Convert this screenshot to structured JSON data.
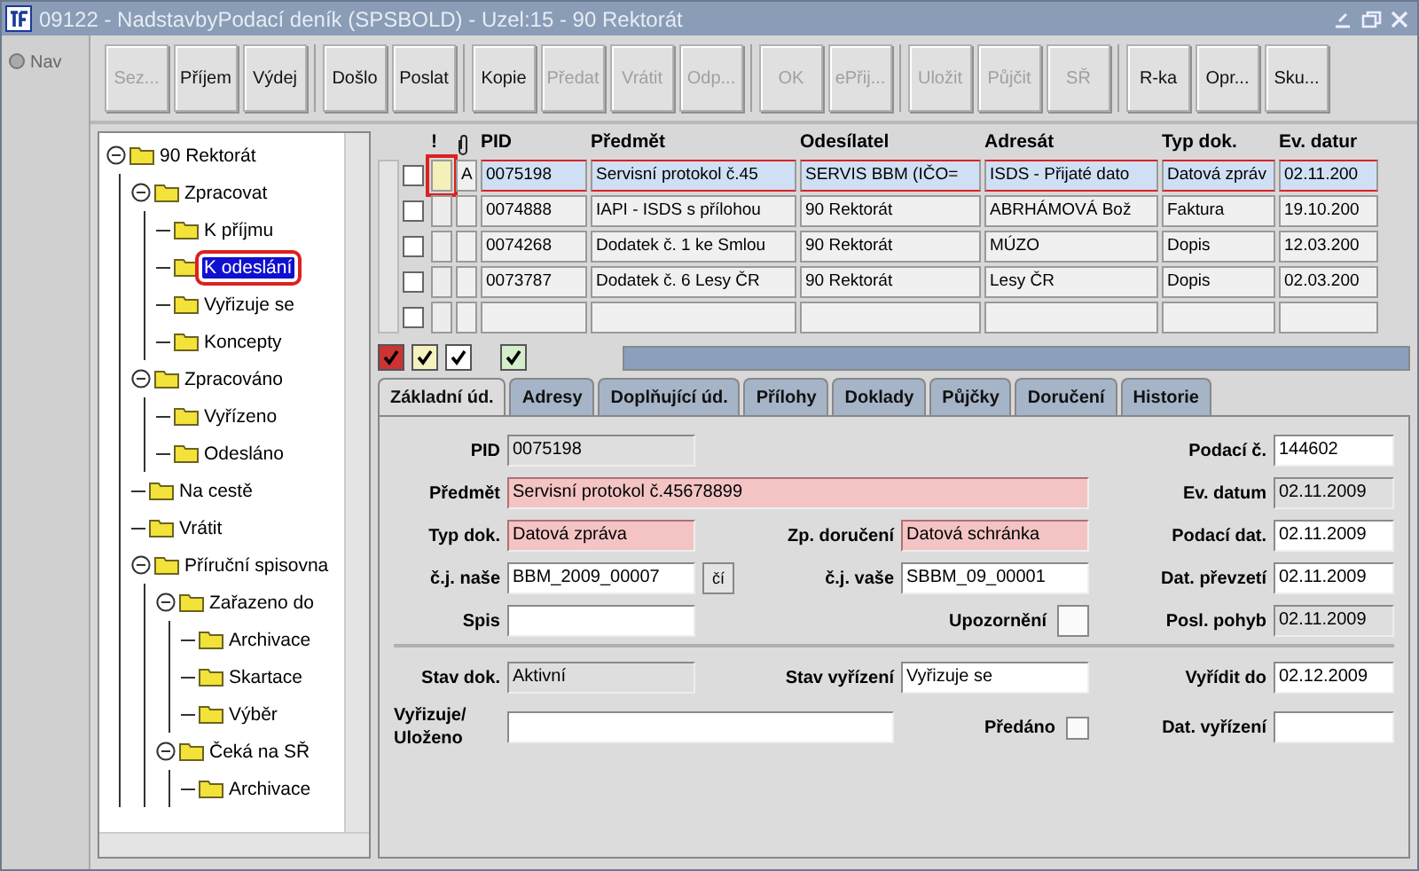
{
  "window": {
    "title": "09122 - NadstavbyPodací deník (SPSBOLD) - Uzel:15 - 90 Rektorát"
  },
  "nav": {
    "label": "Nav"
  },
  "toolbar": {
    "groups": [
      [
        {
          "label": "Sez...",
          "disabled": true
        },
        {
          "label": "Příjem",
          "disabled": false
        },
        {
          "label": "Výdej",
          "disabled": false
        }
      ],
      [
        {
          "label": "Došlo",
          "disabled": false
        },
        {
          "label": "Poslat",
          "disabled": false
        }
      ],
      [
        {
          "label": "Kopie",
          "disabled": false
        },
        {
          "label": "Předat",
          "disabled": true
        },
        {
          "label": "Vrátit",
          "disabled": true
        },
        {
          "label": "Odp...",
          "disabled": true
        }
      ],
      [
        {
          "label": "OK",
          "disabled": true
        },
        {
          "label": "ePřij...",
          "disabled": true
        }
      ],
      [
        {
          "label": "Uložit",
          "disabled": true
        },
        {
          "label": "Půjčit",
          "disabled": true
        },
        {
          "label": "SŘ",
          "disabled": true
        }
      ],
      [
        {
          "label": "R-ka",
          "disabled": false
        },
        {
          "label": "Opr...",
          "disabled": false
        },
        {
          "label": "Sku...",
          "disabled": false
        }
      ]
    ]
  },
  "tree": [
    {
      "label": "90 Rektorát",
      "expanded": true,
      "selected": false,
      "children": [
        {
          "label": "Zpracovat",
          "expanded": true,
          "selected": false,
          "children": [
            {
              "label": "K příjmu",
              "selected": false
            },
            {
              "label": "K odeslání",
              "selected": true
            },
            {
              "label": "Vyřizuje se",
              "selected": false
            },
            {
              "label": "Koncepty",
              "selected": false
            }
          ]
        },
        {
          "label": "Zpracováno",
          "expanded": true,
          "selected": false,
          "children": [
            {
              "label": "Vyřízeno",
              "selected": false
            },
            {
              "label": "Odesláno",
              "selected": false
            }
          ]
        },
        {
          "label": "Na cestě",
          "selected": false
        },
        {
          "label": "Vrátit",
          "selected": false
        },
        {
          "label": "Příruční spisovna",
          "expanded": true,
          "selected": false,
          "children": [
            {
              "label": "Zařazeno do",
              "expanded": true,
              "selected": false,
              "children": [
                {
                  "label": "Archivace",
                  "selected": false
                },
                {
                  "label": "Skartace",
                  "selected": false
                },
                {
                  "label": "Výběr",
                  "selected": false
                }
              ]
            },
            {
              "label": "Čeká na SŘ",
              "expanded": true,
              "selected": false,
              "children": [
                {
                  "label": "Archivace",
                  "selected": false
                }
              ]
            }
          ]
        }
      ]
    }
  ],
  "table": {
    "columns": [
      {
        "kind": "text",
        "label": "!"
      },
      {
        "kind": "attachment"
      },
      {
        "kind": "text",
        "label": "PID"
      },
      {
        "kind": "text",
        "label": "Předmět"
      },
      {
        "kind": "text",
        "label": "Odesílatel"
      },
      {
        "kind": "text",
        "label": "Adresát"
      },
      {
        "kind": "text",
        "label": "Typ dok."
      },
      {
        "kind": "text",
        "label": "Ev. datur"
      }
    ],
    "rows": [
      {
        "selected": true,
        "checked": false,
        "cells": [
          "",
          "A",
          "0075198",
          "Servisní protokol č.45",
          "SERVIS BBM (IČO=",
          "ISDS - Přijaté dato",
          "Datová zpráv",
          "02.11.200"
        ]
      },
      {
        "selected": false,
        "checked": false,
        "cells": [
          "",
          "",
          "0074888",
          "IAPI - ISDS s přílohou",
          "90 Rektorát",
          "ABRHÁMOVÁ Bož",
          "Faktura",
          "19.10.200"
        ]
      },
      {
        "selected": false,
        "checked": false,
        "cells": [
          "",
          "",
          "0074268",
          "Dodatek č. 1 ke Smlou",
          "90 Rektorát",
          "MÚZO",
          "Dopis",
          "12.03.200"
        ]
      },
      {
        "selected": false,
        "checked": false,
        "cells": [
          "",
          "",
          "0073787",
          "Dodatek č. 6 Lesy ČR",
          "90 Rektorát",
          "Lesy ČR",
          "Dopis",
          "02.03.200"
        ]
      },
      {
        "selected": false,
        "checked": false,
        "cells": []
      }
    ]
  },
  "filters": [
    {
      "checked": true,
      "color": "#cc3333"
    },
    {
      "checked": true,
      "color": "#f6f2c0"
    },
    {
      "checked": true,
      "color": "#ffffff"
    },
    {
      "checked": true,
      "color": "#d4eecb"
    }
  ],
  "tabs": [
    {
      "label": "Základní úd.",
      "selected": true
    },
    {
      "label": "Adresy",
      "selected": false
    },
    {
      "label": "Doplňující úd.",
      "selected": false
    },
    {
      "label": "Přílohy",
      "selected": false
    },
    {
      "label": "Doklady",
      "selected": false
    },
    {
      "label": "Půjčky",
      "selected": false
    },
    {
      "label": "Doručení",
      "selected": false
    },
    {
      "label": "Historie",
      "selected": false
    }
  ],
  "form": {
    "sections": [
      [
        {
          "left": {
            "label": "PID",
            "value": "0075198",
            "kind": "text",
            "required": false,
            "readonly": true
          },
          "right": {
            "label": "Podací č.",
            "value": "144602",
            "readonly": false
          }
        },
        {
          "left": {
            "label": "Předmět",
            "value": "Servisní protokol č.45678899",
            "kind": "wide",
            "required": true,
            "readonly": false
          },
          "right": {
            "label": "Ev. datum",
            "value": "02.11.2009",
            "readonly": true
          }
        },
        {
          "left": {
            "label": "Typ dok.",
            "value": "Datová zpráva",
            "kind": "text",
            "required": true,
            "readonly": false
          },
          "middle": {
            "label": "Zp. doručení",
            "value": "Datová schránka",
            "kind": "text",
            "required": true
          },
          "right": {
            "label": "Podací dat.",
            "value": "02.11.2009",
            "readonly": false
          }
        },
        {
          "left": {
            "label": "č.j. naše",
            "value": "BBM_2009_00007",
            "kind": "text",
            "required": false,
            "readonly": false,
            "button": "čí"
          },
          "middle": {
            "label": "č.j. vaše",
            "value": "SBBM_09_00001",
            "kind": "text",
            "required": false
          },
          "right": {
            "label": "Dat. převzetí",
            "value": "02.11.2009",
            "readonly": false
          }
        },
        {
          "left": {
            "label": "Spis",
            "kind": "text",
            "required": false,
            "readonly": false
          },
          "middle": {
            "label": "Upozornění",
            "kind": "short"
          },
          "right": {
            "label": "Posl. pohyb",
            "value": "02.11.2009",
            "readonly": true
          }
        }
      ],
      [
        {
          "left": {
            "label": "Stav dok.",
            "value": "Aktivní",
            "kind": "text",
            "required": false,
            "readonly": true
          },
          "middle": {
            "label": "Stav vyřízení",
            "value": "Vyřizuje se",
            "kind": "text",
            "required": false
          },
          "right": {
            "label": "Vyřídit do",
            "value": "02.12.2009",
            "readonly": false
          }
        },
        {
          "left": {
            "label": "Vyřizuje/ Uloženo",
            "kind": "long",
            "required": false,
            "readonly": false
          },
          "middle": {
            "label": "Předáno",
            "kind": "checkbox",
            "checked": false
          },
          "right": {
            "label": "Dat. vyřízení",
            "readonly": false
          }
        }
      ]
    ]
  }
}
